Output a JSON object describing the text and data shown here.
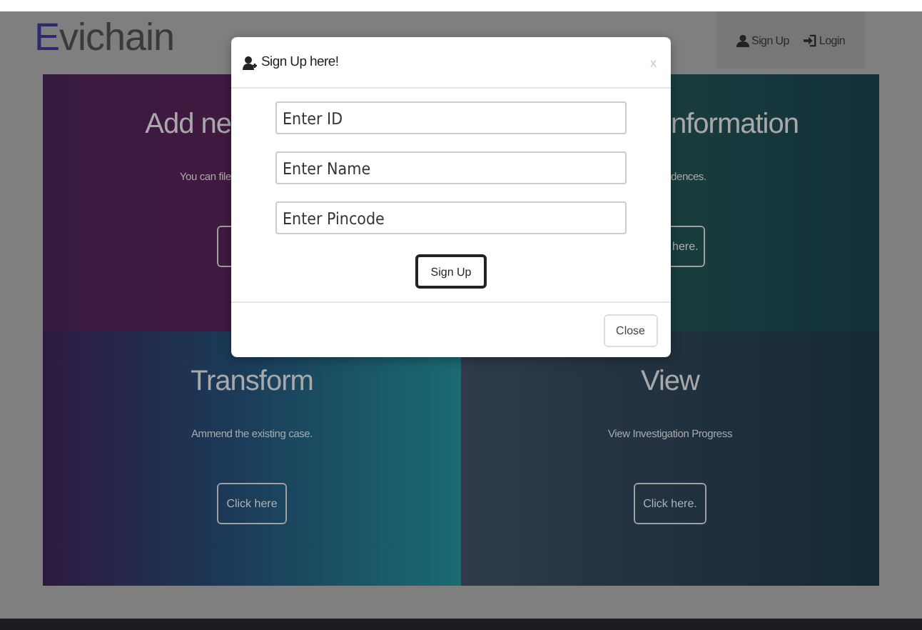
{
  "brand": "Evichain",
  "nav": [
    {
      "kind": "signup",
      "label": "Sign Up"
    },
    {
      "kind": "login",
      "label": "Login"
    }
  ],
  "tiles": [
    {
      "kind": "right",
      "title": "Add ne",
      "text": "You can file"
    },
    {
      "kind": "left",
      "title": "nformation",
      "text": "dences.",
      "button": "here."
    },
    {
      "kind": "full",
      "title": "Transform",
      "text": "Ammend the existing case.",
      "button": "Click here"
    },
    {
      "kind": "full",
      "title": "View",
      "text": "View Investigation Progress",
      "button": "Click here."
    }
  ],
  "modal": {
    "title": "Sign Up here!",
    "close_mark": "x",
    "fields": [
      {
        "placeholder": "Enter ID"
      },
      {
        "placeholder": "Enter Name"
      },
      {
        "placeholder": "Enter Pincode"
      }
    ],
    "submit": "Sign Up",
    "close_button": "Close"
  }
}
